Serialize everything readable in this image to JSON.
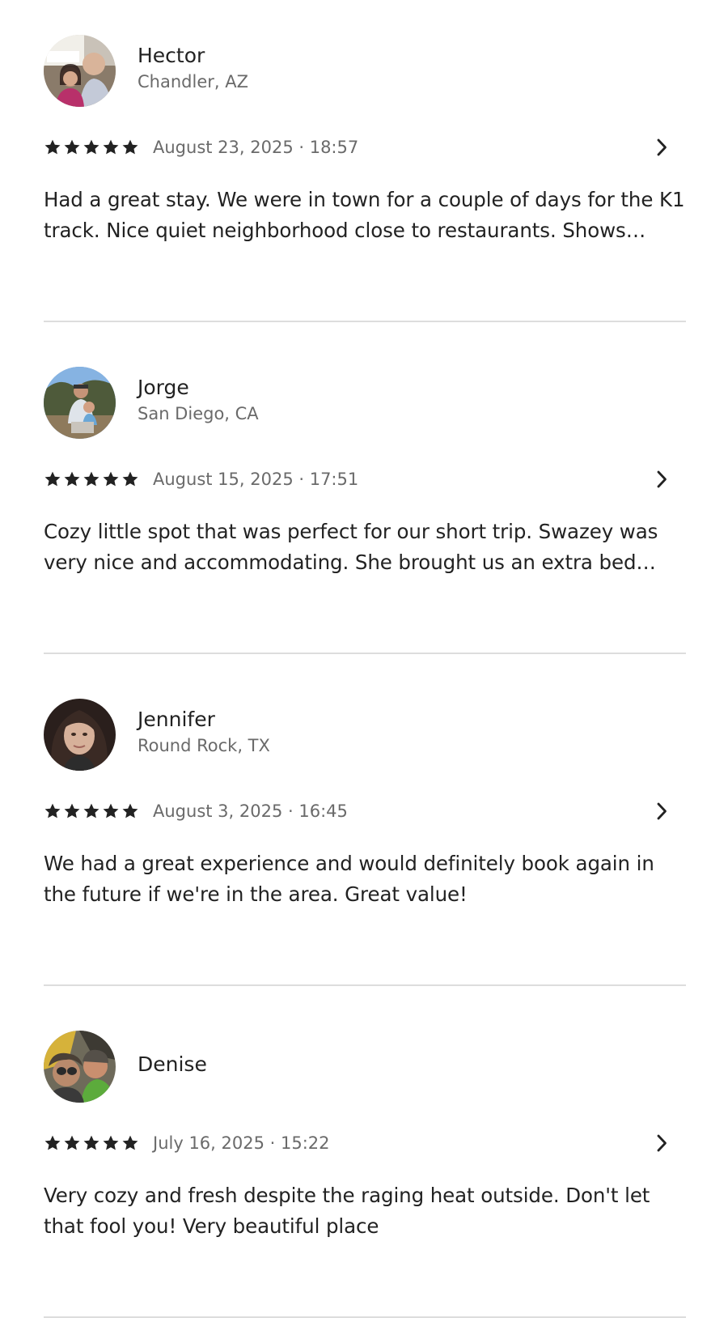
{
  "reviews": [
    {
      "name": "Hector",
      "location": "Chandler, AZ",
      "rating": 5,
      "date": "August 23, 2025 · 18:57",
      "text": "Had a great stay. We were in town for a couple of days for the K1 track. Nice quiet neighborhood close to restaurants. Shows exa…"
    },
    {
      "name": "Jorge",
      "location": "San Diego, CA",
      "rating": 5,
      "date": "August 15, 2025 · 17:51",
      "text": "Cozy little spot that was perfect for our short trip. Swazey was very nice and accommodating. She brought us an extra bed for…"
    },
    {
      "name": "Jennifer",
      "location": "Round Rock, TX",
      "rating": 5,
      "date": "August 3, 2025 · 16:45",
      "text": "We had a great experience and would definitely book again in the future if we're in the area. Great value!"
    },
    {
      "name": "Denise",
      "location": "",
      "rating": 5,
      "date": "July 16, 2025 · 15:22",
      "text": "Very cozy and fresh despite the raging heat outside.  Don't let that fool you! Very beautiful place"
    }
  ],
  "icons": {
    "star": "star-icon",
    "chevron": "chevron-right-icon"
  },
  "colors": {
    "text_primary": "#222222",
    "text_secondary": "#6a6a6a",
    "divider": "#dddddd",
    "star": "#222222"
  }
}
